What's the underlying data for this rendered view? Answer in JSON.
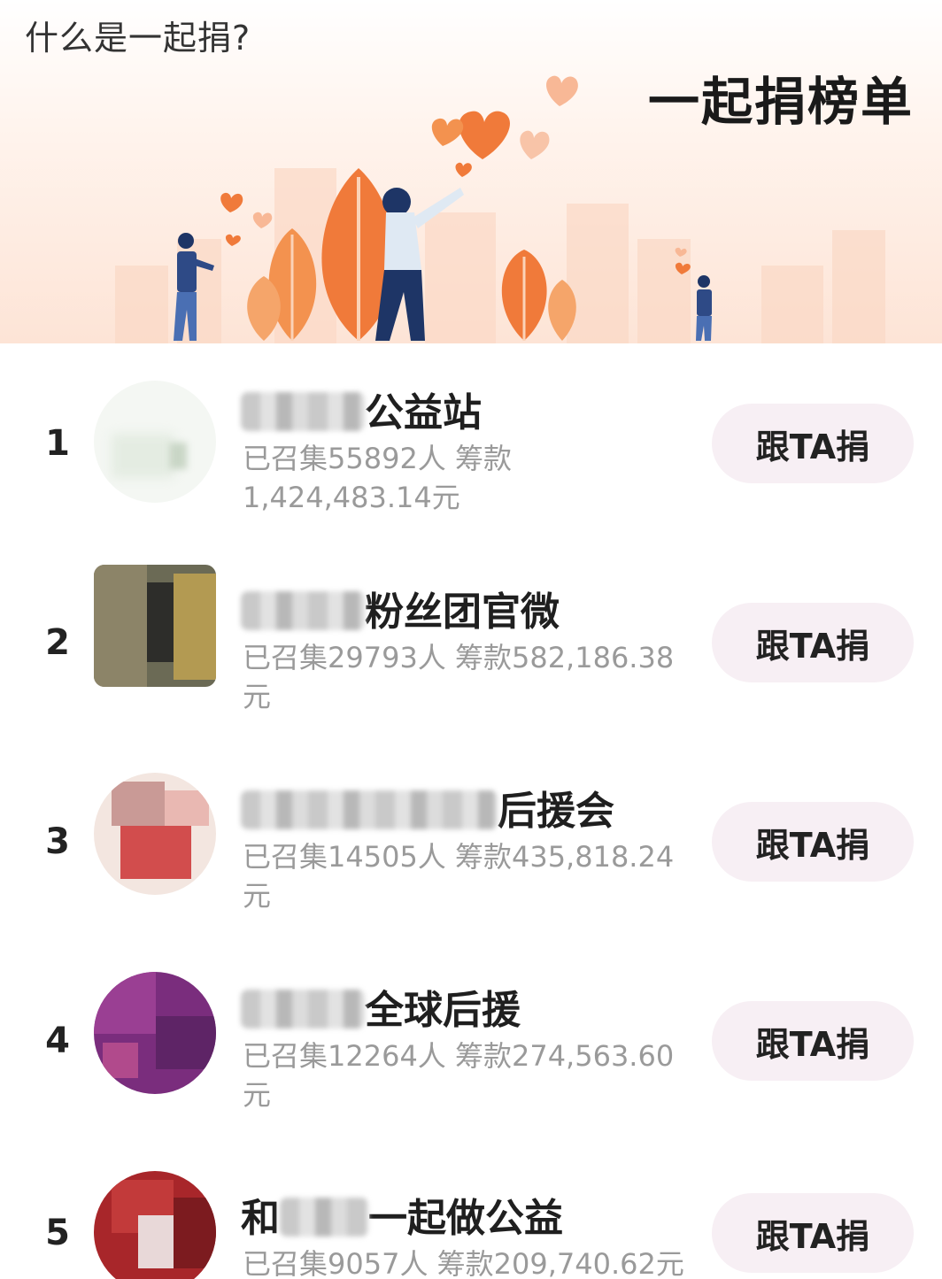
{
  "header": {
    "what_is_link": "什么是一起捐?",
    "board_title": "一起捐榜单"
  },
  "ranking": [
    {
      "rank": "1",
      "name_visible": "公益站",
      "stats": "已召集55892人 筹款 1,424,483.14元",
      "button": "跟TA捐"
    },
    {
      "rank": "2",
      "name_visible": "粉丝团官微",
      "stats": "已召集29793人 筹款582,186.38元",
      "button": "跟TA捐"
    },
    {
      "rank": "3",
      "name_visible": "后援会",
      "stats": "已召集14505人 筹款435,818.24元",
      "button": "跟TA捐"
    },
    {
      "rank": "4",
      "name_visible": "全球后援",
      "stats": "已召集12264人 筹款274,563.60元",
      "button": "跟TA捐"
    },
    {
      "rank": "5",
      "name_prefix": "和",
      "name_visible": "一起做公益",
      "stats": "已召集9057人 筹款209,740.62元",
      "button": "跟TA捐"
    }
  ],
  "colors": {
    "banner_top": "#ffffff",
    "banner_bottom": "#fde4d6",
    "accent_orange": "#f07a3a",
    "button_bg": "#f7eff4",
    "stats_text": "#9a9a9a"
  }
}
